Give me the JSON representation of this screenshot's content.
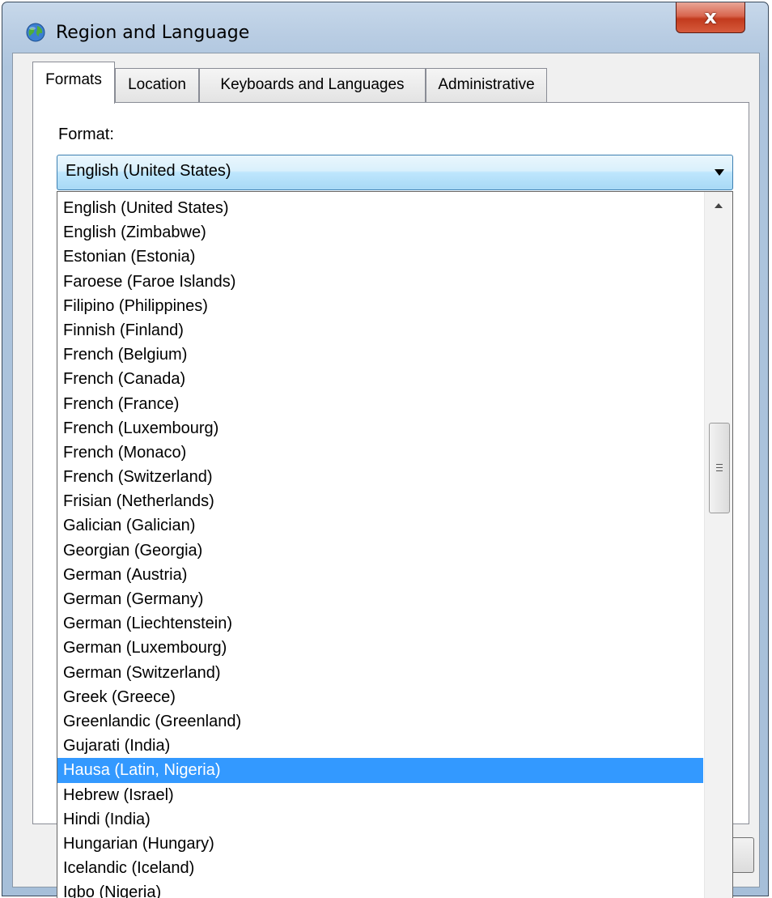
{
  "window": {
    "title": "Region and Language",
    "close_label": "x"
  },
  "icons": {
    "app": "globe-icon",
    "close": "close-icon",
    "dropdown": "chevron-down-icon"
  },
  "tabs": [
    {
      "label": "Formats",
      "active": true
    },
    {
      "label": "Location",
      "active": false
    },
    {
      "label": "Keyboards and Languages",
      "active": false
    },
    {
      "label": "Administrative",
      "active": false
    }
  ],
  "format": {
    "label": "Format:",
    "selected_value": "English (United States)",
    "options": [
      "English (United States)",
      "English (Zimbabwe)",
      "Estonian (Estonia)",
      "Faroese (Faroe Islands)",
      "Filipino (Philippines)",
      "Finnish (Finland)",
      "French (Belgium)",
      "French (Canada)",
      "French (France)",
      "French (Luxembourg)",
      "French (Monaco)",
      "French (Switzerland)",
      "Frisian (Netherlands)",
      "Galician (Galician)",
      "Georgian (Georgia)",
      "German (Austria)",
      "German (Germany)",
      "German (Liechtenstein)",
      "German (Luxembourg)",
      "German (Switzerland)",
      "Greek (Greece)",
      "Greenlandic (Greenland)",
      "Gujarati (India)",
      "Hausa (Latin, Nigeria)",
      "Hebrew (Israel)",
      "Hindi (India)",
      "Hungarian (Hungary)",
      "Icelandic (Iceland)",
      "Igbo (Nigeria)"
    ],
    "highlighted_option": "Hausa (Latin, Nigeria)"
  },
  "colors": {
    "highlight": "#3399ff",
    "highlight_text": "#ffffff",
    "combo_border": "#3c7fb1"
  }
}
